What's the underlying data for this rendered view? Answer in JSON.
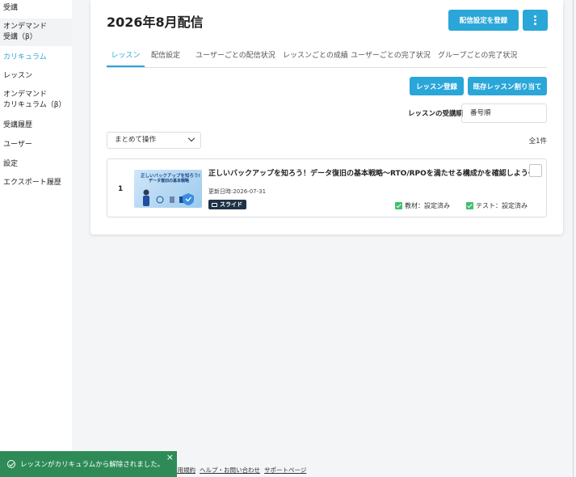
{
  "sidebar": {
    "items": [
      {
        "label": "受講"
      },
      {
        "label": "オンデマンド\n受講（β）"
      },
      {
        "label": "カリキュラム"
      },
      {
        "label": "レッスン"
      },
      {
        "label": "オンデマンド\nカリキュラム（β）"
      },
      {
        "label": "受講履歴"
      },
      {
        "label": "ユーザー"
      },
      {
        "label": "設定"
      },
      {
        "label": "エクスポート履歴"
      }
    ],
    "active_color": "#2aa6d8"
  },
  "header": {
    "title": "2026年8月配信",
    "register_delivery_label": "配信設定を登録",
    "more_icon": "vertical-dots-icon"
  },
  "tabs": [
    {
      "label": "レッスン"
    },
    {
      "label": "配信設定"
    },
    {
      "label": "ユーザーごとの配信状況"
    },
    {
      "label": "レッスンごとの成績"
    },
    {
      "label": "ユーザーごとの完了状況"
    },
    {
      "label": "グループごとの完了状況"
    }
  ],
  "actions": {
    "register_lesson_label": "レッスン登録",
    "assign_existing_label": "既存レッスン割り当て",
    "order_label": "レッスンの受講順",
    "order_value": "番号順",
    "bulk_label": "まとめて操作",
    "count": "全1件"
  },
  "lesson": {
    "number": "1",
    "title": "正しいバックアップを知ろう！データ復旧の基本戦略～RTO/RPOを満たせる構成かを確認しよう～",
    "updated": "更新日時:2026-07-31",
    "badge": "スライド",
    "material_status": "教材：設定済み",
    "test_status": "テスト：設定済み",
    "thumb_line1": "正しいバックアップを知ろう!",
    "thumb_line2": "データ復旧の基本戦略"
  },
  "footer": {
    "terms": "利用規約",
    "help": "ヘルプ・お問い合わせ",
    "support": "サポートページ"
  },
  "toast": {
    "message": "レッスンがカリキュラムから解除されました。",
    "close": "×"
  }
}
